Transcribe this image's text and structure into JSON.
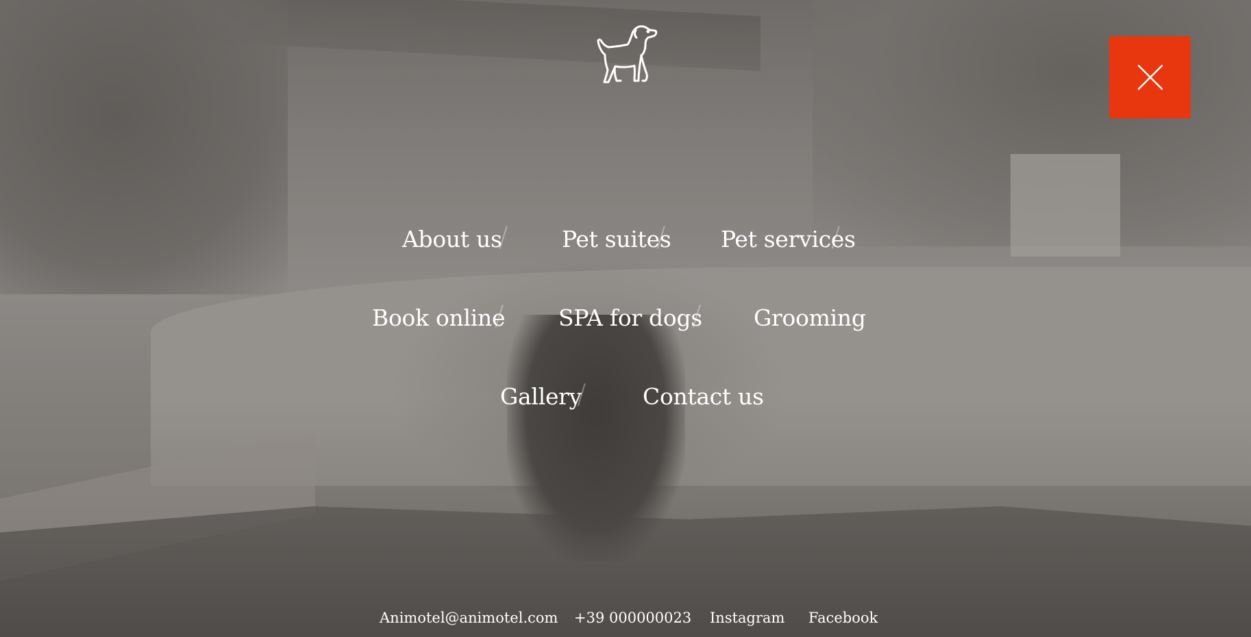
{
  "brand": {
    "logo_icon": "dog-icon"
  },
  "close_icon": "close-icon",
  "colors": {
    "close_button": "#e8360f",
    "text": "#ffffff",
    "overlay": "#7d7976"
  },
  "menu": {
    "items": [
      {
        "label": "About us"
      },
      {
        "label": "Pet suites"
      },
      {
        "label": "Pet services"
      },
      {
        "label": "Book online"
      },
      {
        "label": "SPA for dogs"
      },
      {
        "label": "Grooming"
      },
      {
        "label": "Gallery"
      },
      {
        "label": "Contact us"
      }
    ],
    "separator": "/"
  },
  "footer": {
    "email": "Animotel@animotel.com",
    "phone": "+39 000000023",
    "instagram": "Instagram",
    "facebook": "Facebook"
  }
}
